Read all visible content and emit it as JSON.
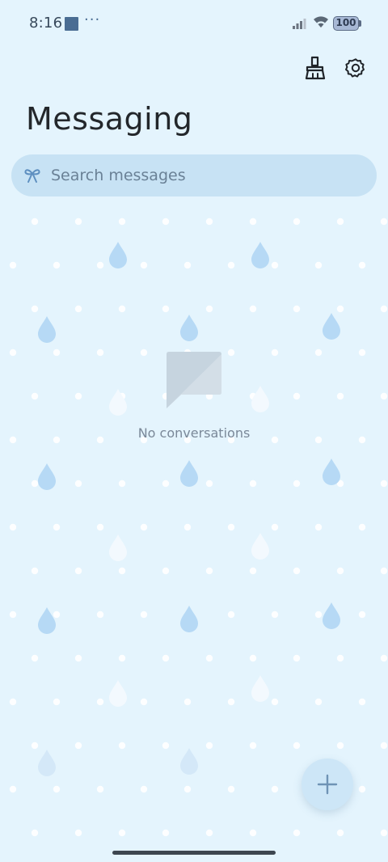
{
  "status_bar": {
    "time": "8:16",
    "dots": "···",
    "battery": "100"
  },
  "header": {
    "title": "Messaging"
  },
  "search": {
    "placeholder": "Search messages"
  },
  "empty_state": {
    "text": "No conversations"
  },
  "colors": {
    "background": "#e4f4fd",
    "accent": "#4a6d93",
    "search_background": "#c6e0f2",
    "fab_background": "#cde6f7"
  },
  "icons": {
    "clean": "broom-icon",
    "settings": "gear-icon",
    "search": "bow-icon",
    "empty": "chat-bubble-icon",
    "fab": "plus-icon"
  }
}
